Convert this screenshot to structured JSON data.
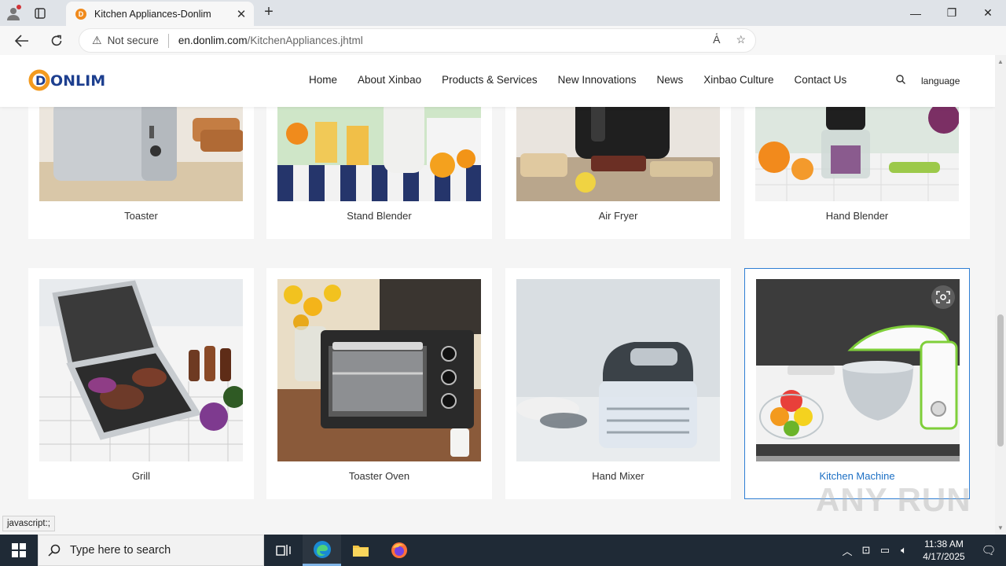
{
  "browser": {
    "tab_title": "Kitchen Appliances-Donlim",
    "tab_favicon_letter": "D",
    "security_label": "Not secure",
    "url_host": "en.donlim.com",
    "url_path": "/KitchenAppliances.jhtml",
    "status_text": "javascript:;"
  },
  "site": {
    "logo_text": "DONLIM",
    "nav": [
      "Home",
      "About Xinbao",
      "Products & Services",
      "New Innovations",
      "News",
      "Xinbao Culture",
      "Contact Us"
    ],
    "language_label": "language"
  },
  "products": [
    {
      "label": "Toaster",
      "icon": "toaster-image"
    },
    {
      "label": "Stand Blender",
      "icon": "stand-blender-image"
    },
    {
      "label": "Air Fryer",
      "icon": "air-fryer-image"
    },
    {
      "label": "Hand Blender",
      "icon": "hand-blender-image"
    },
    {
      "label": "Grill",
      "icon": "grill-image"
    },
    {
      "label": "Toaster Oven",
      "icon": "toaster-oven-image"
    },
    {
      "label": "Hand Mixer",
      "icon": "hand-mixer-image"
    },
    {
      "label": "Kitchen Machine",
      "icon": "kitchen-machine-image"
    }
  ],
  "watermark": "ANY RUN",
  "taskbar": {
    "search_placeholder": "Type here to search",
    "time": "11:38 AM",
    "date": "4/17/2025"
  },
  "colors": {
    "accent_orange": "#f39a1e",
    "brand_blue": "#1d3f8f",
    "active_link": "#1c6fc4"
  }
}
